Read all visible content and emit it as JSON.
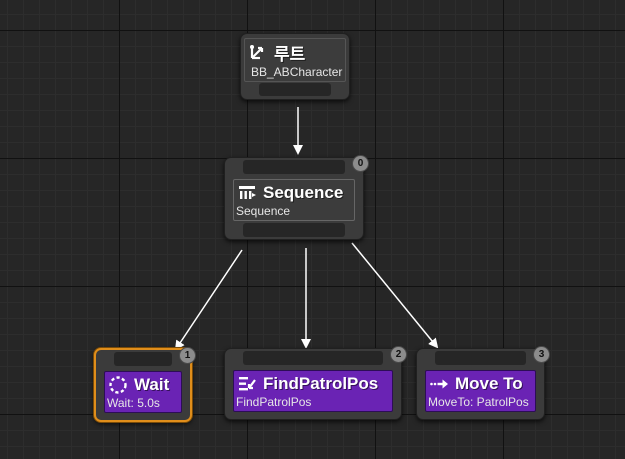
{
  "graph": {
    "root": {
      "title": "루트",
      "subtitle": "BB_ABCharacter",
      "icon": "root-branch-icon"
    },
    "sequence": {
      "title": "Sequence",
      "subtitle": "Sequence",
      "badge": "0",
      "icon": "sequence-icon"
    },
    "tasks": [
      {
        "title": "Wait",
        "subtitle": "Wait: 5.0s",
        "badge": "1",
        "icon": "wait-icon",
        "selected": true
      },
      {
        "title": "FindPatrolPos",
        "subtitle": "FindPatrolPos",
        "badge": "2",
        "icon": "task-list-icon",
        "selected": false
      },
      {
        "title": "Move To",
        "subtitle": "MoveTo: PatrolPos",
        "badge": "3",
        "icon": "move-to-icon",
        "selected": false
      }
    ]
  },
  "colors": {
    "background": "#262626",
    "node": "#3b3b3b",
    "task": "#6a23b4",
    "selected_border": "#e08e1b",
    "wire": "#ffffff"
  }
}
